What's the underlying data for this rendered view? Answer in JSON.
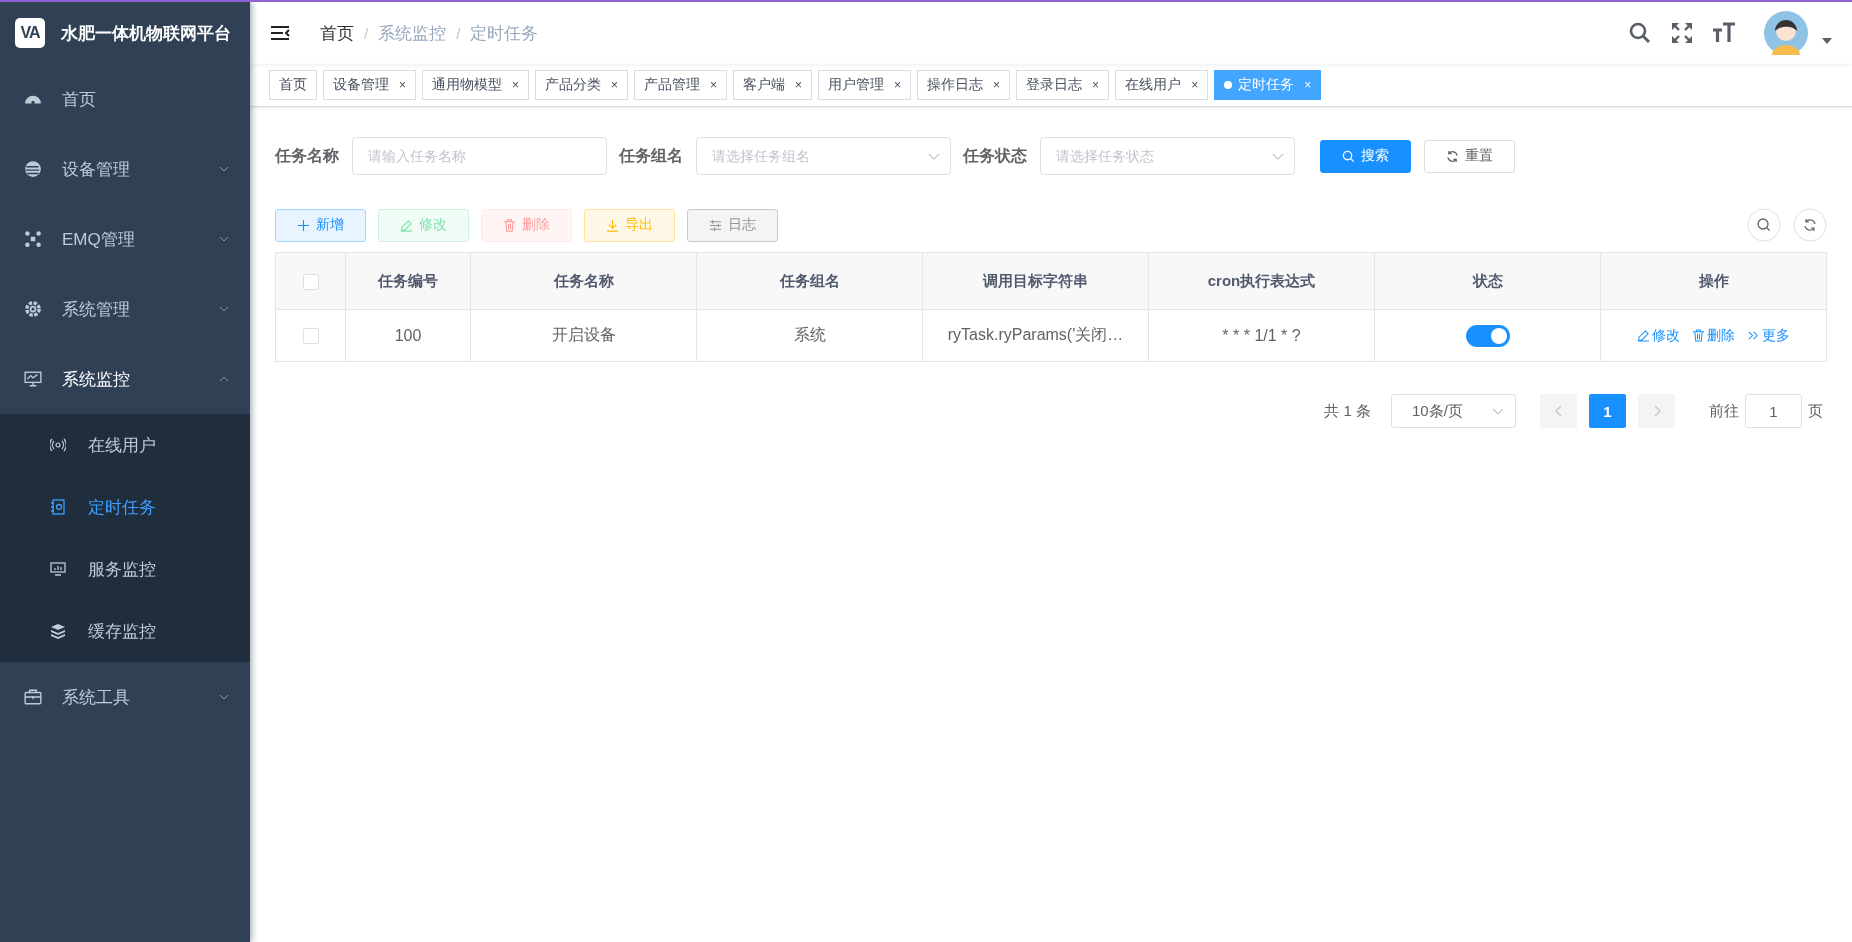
{
  "sidebar": {
    "logo_mark": "VA",
    "title": "水肥一体机物联网平台",
    "menu": [
      {
        "label": "首页",
        "kind": "item"
      },
      {
        "label": "设备管理",
        "kind": "submenu",
        "expanded": false
      },
      {
        "label": "EMQ管理",
        "kind": "submenu",
        "expanded": false
      },
      {
        "label": "系统管理",
        "kind": "submenu",
        "expanded": false
      },
      {
        "label": "系统监控",
        "kind": "submenu",
        "expanded": true,
        "children": [
          {
            "label": "在线用户",
            "selected": false
          },
          {
            "label": "定时任务",
            "selected": true
          },
          {
            "label": "服务监控",
            "selected": false
          },
          {
            "label": "缓存监控",
            "selected": false
          }
        ]
      },
      {
        "label": "系统工具",
        "kind": "submenu",
        "expanded": false
      }
    ]
  },
  "breadcrumb": [
    "首页",
    "系统监控",
    "定时任务"
  ],
  "breadcrumb_separator": "/",
  "tags": [
    {
      "label": "首页",
      "selected": false
    },
    {
      "label": "设备管理",
      "selected": false,
      "close": "×"
    },
    {
      "label": "通用物模型",
      "selected": false,
      "close": "×"
    },
    {
      "label": "产品分类",
      "selected": false,
      "close": "×"
    },
    {
      "label": "产品管理",
      "selected": false,
      "close": "×"
    },
    {
      "label": "客户端",
      "selected": false,
      "close": "×"
    },
    {
      "label": "用户管理",
      "selected": false,
      "close": "×"
    },
    {
      "label": "操作日志",
      "selected": false,
      "close": "×"
    },
    {
      "label": "登录日志",
      "selected": false,
      "close": "×"
    },
    {
      "label": "在线用户",
      "selected": false,
      "close": "×"
    },
    {
      "label": "定时任务",
      "selected": true,
      "close": "×"
    }
  ],
  "filters": [
    {
      "label": "任务名称",
      "kind": "input",
      "placeholder": "请输入任务名称"
    },
    {
      "label": "任务组名",
      "kind": "select",
      "placeholder": "请选择任务组名"
    },
    {
      "label": "任务状态",
      "kind": "select",
      "placeholder": "请选择任务状态"
    }
  ],
  "form_buttons": [
    {
      "label": "搜索",
      "kind": "primary"
    },
    {
      "label": "重置",
      "kind": "default"
    }
  ],
  "toolbar": [
    {
      "label": "新增",
      "kind": "primary",
      "disabled": false
    },
    {
      "label": "修改",
      "kind": "success",
      "disabled": true
    },
    {
      "label": "删除",
      "kind": "danger",
      "disabled": true
    },
    {
      "label": "导出",
      "kind": "warning",
      "disabled": false
    },
    {
      "label": "日志",
      "kind": "info",
      "disabled": false
    }
  ],
  "table": {
    "select_all_checked": false,
    "columns": [
      "任务编号",
      "任务名称",
      "任务组名",
      "调用目标字符串",
      "cron执行表达式",
      "状态",
      "操作"
    ],
    "rows": [
      {
        "checked": false,
        "cells": [
          "100",
          "开启设备",
          "系统",
          "ryTask.ryParams('关闭…",
          "* * * 1/1 * ?"
        ],
        "status_on": true,
        "actions": [
          "修改",
          "删除",
          "更多"
        ]
      }
    ]
  },
  "pagination": {
    "total": "共 1 条",
    "page_size": "10条/页",
    "pages": [
      {
        "label": "1",
        "selected": true
      }
    ],
    "goto_label": "前往",
    "goto_value": "1",
    "goto_suffix": "页"
  }
}
